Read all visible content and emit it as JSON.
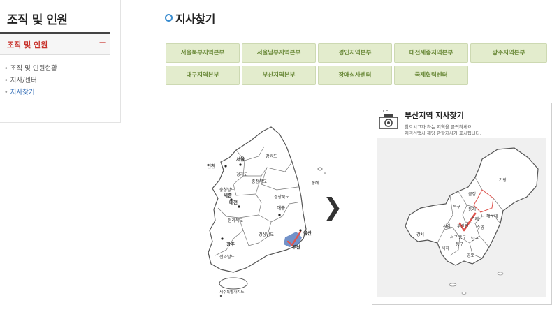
{
  "sidebar": {
    "title": "조직 및 인원",
    "submenu_label": "조직 및 인원",
    "submenu_toggle": "−",
    "items": [
      {
        "label": "조직 및 인원현황"
      },
      {
        "label": "지사/센터"
      },
      {
        "label": "지사찾기"
      }
    ]
  },
  "main": {
    "title": "지사찾기",
    "tabs": [
      {
        "label": "서울북부지역본부"
      },
      {
        "label": "서울남부지역본부"
      },
      {
        "label": "경인지역본부"
      },
      {
        "label": "대전세종지역본부"
      },
      {
        "label": "광주지역본부"
      },
      {
        "label": "대구지역본부"
      },
      {
        "label": "부산지역본부"
      },
      {
        "label": "장애심사센터"
      },
      {
        "label": "국제협력센터"
      }
    ],
    "arrow": "❯"
  },
  "korea_map": {
    "regions": {
      "incheon": "인천",
      "seoul": "서울",
      "gyeonggi": "경기도",
      "gangwon": "강원도",
      "donghae": "동해",
      "chungbuk": "충청북도",
      "chungnam": "충청남도",
      "sejong": "세종",
      "daejeon": "대전",
      "gyeongbuk": "경상북도",
      "daegu": "대구",
      "jeonbuk": "전라북도",
      "gyeongnam": "경상남도",
      "ulsan": "울산",
      "gwangju": "광주",
      "busan": "부산",
      "jeonnam": "전라남도",
      "jeju": "제주특별자치도"
    },
    "highlight_color": "#5a7fbf"
  },
  "busan_panel": {
    "title": "부산지역 지사찾기",
    "desc1": "찾으시고자 하는 지역을 클릭하세요.",
    "desc2": "지역선택시 해당 관할지사가 표시됩니다.",
    "districts": {
      "gijang": "기장",
      "geumjeong": "금정",
      "bukgu": "북구",
      "dongnae": "동래",
      "haeundae": "해운대",
      "sasang": "사상",
      "busanjin": "부산진",
      "yeonje": "연제",
      "suyeong": "수영",
      "gangseo": "강서",
      "seogu": "서구",
      "junggu": "중구",
      "namgu": "남구",
      "saha": "사하",
      "donggu": "동구",
      "yeongdo": "영도"
    },
    "check_color": "#e0554f"
  }
}
